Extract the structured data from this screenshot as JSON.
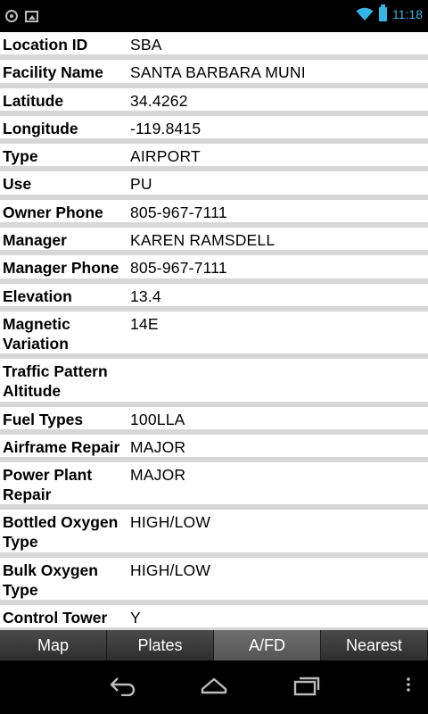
{
  "status_bar": {
    "time": "11:18",
    "icons": [
      "gps-icon",
      "image-icon",
      "wifi-icon",
      "battery-icon"
    ]
  },
  "rows": [
    {
      "label": "Location ID",
      "value": "SBA"
    },
    {
      "label": "Facility Name",
      "value": "SANTA BARBARA MUNI"
    },
    {
      "label": "Latitude",
      "value": "34.4262"
    },
    {
      "label": "Longitude",
      "value": "-119.8415"
    },
    {
      "label": "Type",
      "value": "AIRPORT"
    },
    {
      "label": "Use",
      "value": "PU"
    },
    {
      "label": "Owner Phone",
      "value": "805-967-7111"
    },
    {
      "label": "Manager",
      "value": "KAREN RAMSDELL"
    },
    {
      "label": "Manager Phone",
      "value": "805-967-7111"
    },
    {
      "label": "Elevation",
      "value": "13.4"
    },
    {
      "label": "Magnetic Variation",
      "value": "14E"
    },
    {
      "label": "Traffic Pattern Altitude",
      "value": ""
    },
    {
      "label": "Fuel Types",
      "value": "100LLA"
    },
    {
      "label": "Airframe Repair",
      "value": "MAJOR"
    },
    {
      "label": "Power Plant Repair",
      "value": "MAJOR"
    },
    {
      "label": "Bottled Oxygen Type",
      "value": "HIGH/LOW"
    },
    {
      "label": "Bulk Oxygen Type",
      "value": "HIGH/LOW"
    },
    {
      "label": "Control Tower",
      "value": "Y"
    }
  ],
  "tabs": [
    {
      "label": "Map",
      "active": false
    },
    {
      "label": "Plates",
      "active": false
    },
    {
      "label": "A/FD",
      "active": true
    },
    {
      "label": "Nearest",
      "active": false
    }
  ],
  "nav": [
    "back-icon",
    "home-icon",
    "recent-apps-icon",
    "menu-icon"
  ]
}
